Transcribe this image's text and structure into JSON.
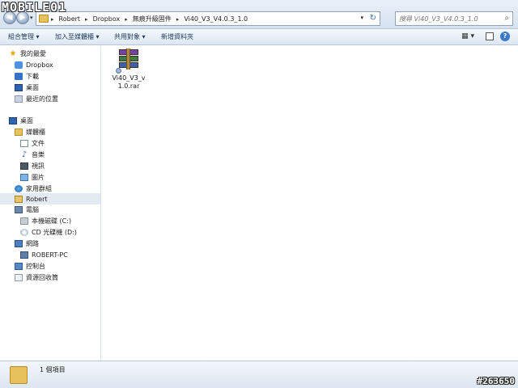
{
  "watermark": {
    "logo": "MOBILE01",
    "id": "#263650"
  },
  "address_bar": {
    "breadcrumbs": [
      "Robert",
      "Dropbox",
      "無痕升級固件",
      "Vi40_V3_V4.0.3_1.0"
    ],
    "search_placeholder": "搜尋 Vi40_V3_V4.0.3_1.0"
  },
  "toolbar": {
    "organize": "組合管理 ▾",
    "include_in_library": "加入至媒體櫃 ▾",
    "share_with": "共用對象 ▾",
    "new_folder": "新增資料夾"
  },
  "sidebar": {
    "items": [
      {
        "label": "我的最愛",
        "icon": "star-icon"
      },
      {
        "label": "Dropbox",
        "icon": "dropbox-icon"
      },
      {
        "label": "下載",
        "icon": "download-icon"
      },
      {
        "label": "桌面",
        "icon": "desktop-icon"
      },
      {
        "label": "最近的位置",
        "icon": "recent-places-icon"
      },
      {
        "label": "桌面",
        "icon": "desktop-icon"
      },
      {
        "label": "媒體櫃",
        "icon": "library-icon"
      },
      {
        "label": "文件",
        "icon": "document-icon"
      },
      {
        "label": "音樂",
        "icon": "music-icon"
      },
      {
        "label": "視訊",
        "icon": "video-icon"
      },
      {
        "label": "圖片",
        "icon": "picture-icon"
      },
      {
        "label": "家用群組",
        "icon": "homegroup-icon"
      },
      {
        "label": "Robert",
        "icon": "user-folder-icon",
        "selected": true
      },
      {
        "label": "電腦",
        "icon": "computer-icon"
      },
      {
        "label": "本機磁碟 (C:)",
        "icon": "drive-icon"
      },
      {
        "label": "CD 光碟機 (D:)",
        "icon": "cd-drive-icon"
      },
      {
        "label": "網路",
        "icon": "network-icon"
      },
      {
        "label": "ROBERT-PC",
        "icon": "pc-icon"
      },
      {
        "label": "控制台",
        "icon": "control-panel-icon"
      },
      {
        "label": "資源回收筒",
        "icon": "recycle-bin-icon"
      }
    ]
  },
  "files": [
    {
      "name": "Vi40_V3_v1.0.rar",
      "icon": "winrar-archive-icon"
    }
  ],
  "status": {
    "item_count": "1 個項目"
  },
  "colors": {
    "selection": "#e4eaf2",
    "chrome": "#dce6f1",
    "accent": "#3a78c9"
  }
}
